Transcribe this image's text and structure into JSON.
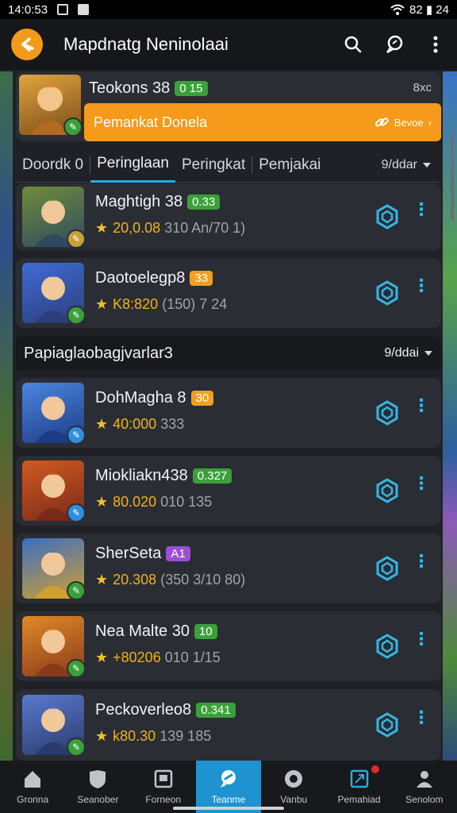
{
  "status_bar": {
    "time": "14:0:53",
    "battery": "82 ▮ 24"
  },
  "app_bar": {
    "title": "Mapdnatg Neninolaai"
  },
  "top_card": {
    "name": "Teokons 38",
    "tag": "0 15",
    "right_text": "8xc",
    "banner_text": "Pemankat Donela",
    "banner_action": "Bevoe"
  },
  "tabs": {
    "items": [
      {
        "label": "Doordk 0"
      },
      {
        "label": "Peringlaan"
      },
      {
        "label": "Peringkat"
      },
      {
        "label": "Pemjakai"
      }
    ],
    "sort_label": "9/ddar"
  },
  "section": {
    "title": "Papiaglaobagjvarlar3",
    "sort_label": "9/ddai"
  },
  "players": [
    {
      "name": "Maghtigh 38",
      "tag": "0.33",
      "tag_color": "green",
      "points": "20,0.08",
      "extra": "310 An/70 1)",
      "badge_color": "#c7a13a",
      "colors": [
        "#6f8c3c",
        "#2f4a5f"
      ]
    },
    {
      "name": "Daotoelegp8",
      "tag": "33",
      "tag_color": "orange",
      "points": "K8:820",
      "extra": "(150) 7 24",
      "badge_color": "#3aa13a",
      "colors": [
        "#3f6bd6",
        "#2c3f7a"
      ]
    },
    {
      "name": "DohMagha 8",
      "tag": "30",
      "tag_color": "orange",
      "points": "40:000",
      "extra": "333",
      "badge_color": "#2e8fe0",
      "colors": [
        "#4a86e0",
        "#1e3b85"
      ]
    },
    {
      "name": "Miokliakn438",
      "tag": "0.327",
      "tag_color": "green",
      "points": "80.020",
      "extra": "010 135",
      "badge_color": "#2e8fe0",
      "colors": [
        "#d05a22",
        "#7a2a18"
      ]
    },
    {
      "name": "SherSeta",
      "tag": "A1",
      "tag_color": "purple",
      "points": "20.308",
      "extra": "(350 3/10 80)",
      "badge_color": "#3aa13a",
      "colors": [
        "#3b6ec2",
        "#d0a030"
      ]
    },
    {
      "name": "Nea Malte 30",
      "tag": "10",
      "tag_color": "green",
      "points": "+80206",
      "extra": "010 1/15",
      "badge_color": "#3aa13a",
      "colors": [
        "#e08a28",
        "#8a3a1a"
      ]
    },
    {
      "name": "Peckoverleo8",
      "tag": "0.341",
      "tag_color": "green",
      "points": "k80.30",
      "extra": "139 185",
      "badge_color": "#3aa13a",
      "colors": [
        "#5a7ad0",
        "#2a3a6a"
      ]
    }
  ],
  "navbar": {
    "items": [
      {
        "label": "Gronna"
      },
      {
        "label": "Seanober"
      },
      {
        "label": "Forneon"
      },
      {
        "label": "Teanme"
      },
      {
        "label": "Vanbu"
      },
      {
        "label": "Pemahiad"
      },
      {
        "label": "Senolom"
      }
    ],
    "active_index": 3
  },
  "colors": {
    "accent": "#f39a1b",
    "active": "#1e93d0",
    "hex": "#33b8e8"
  }
}
